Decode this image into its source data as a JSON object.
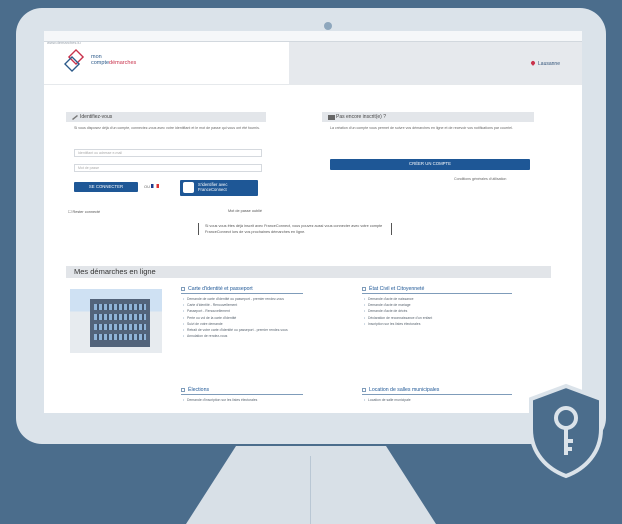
{
  "address_bar": "www.demarches.lu",
  "header": {
    "logo_line1": "mon",
    "logo_line2": "compte",
    "logo_line3": "démarches",
    "location": "Lausanne"
  },
  "identify": {
    "title": "Identifiez-vous",
    "intro": "Si vous disposez déjà d'un compte, connectez-vous avec votre identifiant et le mot de passe qui vous ont été fournis.",
    "login_placeholder": "Identifiant ou adresse e-mail",
    "password_placeholder": "Mot de passe",
    "login_button": "SE CONNECTER",
    "or": "OU",
    "franceconnect_line1": "S'identifier avec",
    "franceconnect_line2": "FranceConnect",
    "remember": "Rester connecté",
    "forgot": "Mot de passe oublié",
    "notice": "Si vous vous êtes déjà inscrit avec FranceConnect, vous pouvez aussi vous connecter avec votre compte FranceConnect lors de vos prochaines démarches en ligne."
  },
  "no_account": {
    "title": "Pas encore inscrit(e) ?",
    "intro": "La création d'un compte vous permet de suivre vos démarches en ligne et de recevoir vos notifications par courriel.",
    "create_button": "CRÉER UN COMPTE",
    "terms_link": "Conditions générales d'utilisation"
  },
  "section_title": "Mes démarches en ligne",
  "categories": [
    {
      "title": "Carte d'identité et passeport",
      "items": [
        "Demande de carte d'identité ou passeport - premier rendez-vous",
        "Carte d'identité - Renouvellement",
        "Passeport - Renouvellement",
        "Perte ou vol de la carte d'identité",
        "Suivi de votre demande",
        "Retrait de votre carte d'identité ou passeport - premier rendez-vous",
        "Annulation de rendez-vous"
      ]
    },
    {
      "title": "État Civil et Citoyenneté",
      "items": [
        "Demande d'acte de naissance",
        "Demande d'acte de mariage",
        "Demande d'acte de décès",
        "Déclaration de reconnaissance d'un enfant",
        "Inscription sur les listes électorales"
      ]
    },
    {
      "title": "Élections",
      "items": [
        "Demande d'inscription sur les listes électorales"
      ]
    },
    {
      "title": "Location de salles municipales",
      "items": [
        "Location de salle municipale"
      ]
    }
  ],
  "colors": {
    "background": "#4b6d8c",
    "monitor": "#dbe3ea",
    "accent": "#1e5796",
    "brand_red": "#c9324b"
  }
}
